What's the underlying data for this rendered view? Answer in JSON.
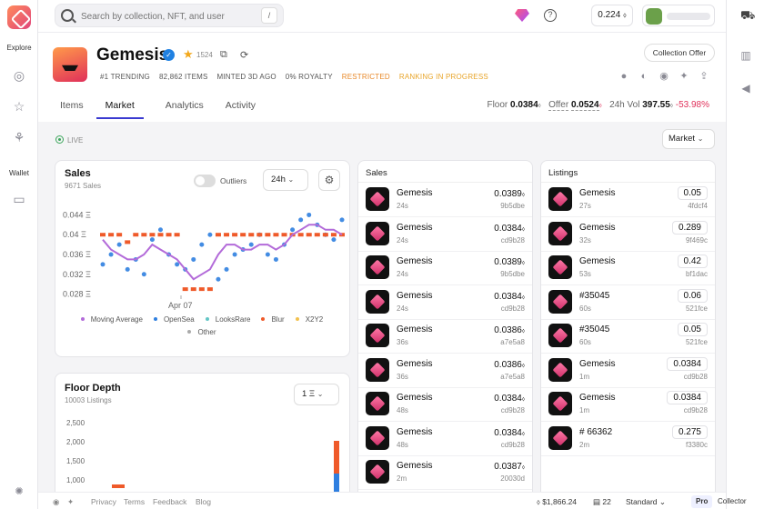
{
  "nav": {
    "explore_label": "Explore",
    "wallet_label": "Wallet"
  },
  "topbar": {
    "search_placeholder": "Search by collection, NFT, and user",
    "search_shortcut": "/",
    "balance": "0.224"
  },
  "collection": {
    "name": "Gemesis",
    "star_count": "1524",
    "tags": [
      "#1 TRENDING",
      "82,862 ITEMS",
      "MINTED 3D AGO",
      "0% ROYALTY"
    ],
    "restricted": "RESTRICTED",
    "ranking": "RANKING IN PROGRESS",
    "offer_button": "Collection Offer"
  },
  "tabs": [
    "Items",
    "Market",
    "Analytics",
    "Activity"
  ],
  "stats": {
    "floor_label": "Floor",
    "floor_value": "0.0384",
    "offer_label": "Offer",
    "offer_value": "0.0524",
    "vol_label": "24h Vol",
    "vol_value": "397.55",
    "vol_change": "-53.98%"
  },
  "market": {
    "live_label": "LIVE",
    "dropdown": "Market"
  },
  "sales_chart": {
    "title": "Sales",
    "subtitle": "9671 Sales",
    "outliers_label": "Outliers",
    "period": "24h",
    "legend": [
      "Moving Average",
      "OpenSea",
      "LooksRare",
      "Blur",
      "X2Y2",
      "Other"
    ],
    "legend_colors": [
      "#b36bd9",
      "#2f7fe0",
      "#63c6c6",
      "#ef5a2a",
      "#f2c14e",
      "#aaaaaa"
    ]
  },
  "chart_data": {
    "type": "scatter",
    "yticks": [
      "0.044 Ξ",
      "0.04 Ξ",
      "0.036 Ξ",
      "0.032 Ξ",
      "0.028 Ξ"
    ],
    "ytick_values": [
      0.044,
      0.04,
      0.036,
      0.032,
      0.028
    ],
    "xtick": "Apr 07",
    "ylim": [
      0.027,
      0.045
    ],
    "series": [
      {
        "name": "OpenSea",
        "values": [
          0.034,
          0.036,
          0.038,
          0.033,
          0.035,
          0.032,
          0.039,
          0.041,
          0.036,
          0.034,
          0.033,
          0.035,
          0.038,
          0.04,
          0.031,
          0.033,
          0.036,
          0.037,
          0.038,
          0.04,
          0.036,
          0.035,
          0.038,
          0.041,
          0.043,
          0.044,
          0.042,
          0.04,
          0.039,
          0.043
        ]
      },
      {
        "name": "Blur",
        "values": [
          0.04,
          0.04,
          0.04,
          0.0385,
          0.04,
          0.04,
          0.04,
          0.04,
          0.04,
          0.04,
          0.029,
          0.029,
          0.029,
          0.029,
          0.04,
          0.04,
          0.04,
          0.04,
          0.04,
          0.04,
          0.04,
          0.04,
          0.04,
          0.04,
          0.04,
          0.04,
          0.04,
          0.04,
          0.04,
          0.04
        ]
      },
      {
        "name": "Moving Average",
        "values": [
          0.039,
          0.037,
          0.036,
          0.035,
          0.035,
          0.036,
          0.038,
          0.037,
          0.036,
          0.035,
          0.033,
          0.031,
          0.032,
          0.033,
          0.036,
          0.038,
          0.038,
          0.037,
          0.037,
          0.038,
          0.038,
          0.037,
          0.038,
          0.04,
          0.041,
          0.042,
          0.042,
          0.041,
          0.041,
          0.04
        ]
      }
    ]
  },
  "floor_depth": {
    "title": "Floor Depth",
    "subtitle": "10003 Listings",
    "unit_dd": "1 Ξ",
    "yticks": [
      "2,500",
      "2,000",
      "1,500",
      "1,000"
    ]
  },
  "sales_list": {
    "title": "Sales",
    "rows": [
      {
        "name": "Gemesis",
        "time": "24s",
        "price": "0.0389",
        "addr": "9b5dbe"
      },
      {
        "name": "Gemesis",
        "time": "24s",
        "price": "0.0384",
        "addr": "cd9b28"
      },
      {
        "name": "Gemesis",
        "time": "24s",
        "price": "0.0389",
        "addr": "9b5dbe"
      },
      {
        "name": "Gemesis",
        "time": "24s",
        "price": "0.0384",
        "addr": "cd9b28"
      },
      {
        "name": "Gemesis",
        "time": "36s",
        "price": "0.0386",
        "addr": "a7e5a8"
      },
      {
        "name": "Gemesis",
        "time": "36s",
        "price": "0.0386",
        "addr": "a7e5a8"
      },
      {
        "name": "Gemesis",
        "time": "48s",
        "price": "0.0384",
        "addr": "cd9b28"
      },
      {
        "name": "Gemesis",
        "time": "48s",
        "price": "0.0384",
        "addr": "cd9b28"
      },
      {
        "name": "Gemesis",
        "time": "2m",
        "price": "0.0387",
        "addr": "20030d"
      }
    ]
  },
  "listings": {
    "title": "Listings",
    "rows": [
      {
        "name": "Gemesis",
        "time": "27s",
        "price": "0.05",
        "addr": "4fdcf4"
      },
      {
        "name": "Gemesis",
        "time": "32s",
        "price": "0.289",
        "addr": "9f469c"
      },
      {
        "name": "Gemesis",
        "time": "53s",
        "price": "0.42",
        "addr": "bf1dac"
      },
      {
        "name": "#35045",
        "time": "60s",
        "price": "0.06",
        "addr": "521fce"
      },
      {
        "name": "#35045",
        "time": "60s",
        "price": "0.05",
        "addr": "521fce"
      },
      {
        "name": "Gemesis",
        "time": "1m",
        "price": "0.0384",
        "addr": "cd9b28"
      },
      {
        "name": "Gemesis",
        "time": "1m",
        "price": "0.0384",
        "addr": "cd9b28"
      },
      {
        "name": "# 66362",
        "time": "2m",
        "price": "0.275",
        "addr": "f3380c"
      }
    ]
  },
  "footer": {
    "links": [
      "Privacy",
      "Terms",
      "Feedback",
      "Blog"
    ],
    "eth_price": "$1,866.24",
    "gas": "22",
    "mode": "Standard",
    "pro": "Pro",
    "collector": "Collector"
  }
}
